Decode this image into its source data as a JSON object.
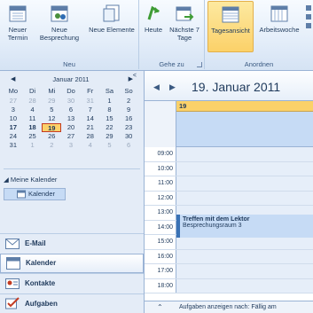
{
  "ribbon": {
    "groups": [
      {
        "label": "Neu",
        "buttons": [
          {
            "label": "Neuer Termin"
          },
          {
            "label": "Neue Besprechung"
          },
          {
            "label": "Neue Elemente"
          }
        ]
      },
      {
        "label": "Gehe zu",
        "buttons": [
          {
            "label": "Heute"
          },
          {
            "label": "Nächste 7 Tage"
          }
        ]
      },
      {
        "label": "Anordnen",
        "buttons": [
          {
            "label": "Tagesansicht"
          },
          {
            "label": "Arbeitswoche"
          }
        ]
      }
    ]
  },
  "mini_calendar": {
    "month": "Januar 2011",
    "weekdays": [
      "Mo",
      "Di",
      "Mi",
      "Do",
      "Fr",
      "Sa",
      "So"
    ],
    "weeks": [
      [
        "27",
        "28",
        "29",
        "30",
        "31",
        "1",
        "2"
      ],
      [
        "3",
        "4",
        "5",
        "6",
        "7",
        "8",
        "9"
      ],
      [
        "10",
        "11",
        "12",
        "13",
        "14",
        "15",
        "16"
      ],
      [
        "17",
        "18",
        "19",
        "20",
        "21",
        "22",
        "23"
      ],
      [
        "24",
        "25",
        "26",
        "27",
        "28",
        "29",
        "30"
      ],
      [
        "31",
        "1",
        "2",
        "3",
        "4",
        "5",
        "6"
      ]
    ],
    "selected_day": "19"
  },
  "calendars": {
    "group": "Meine Kalender",
    "items": [
      "Kalender"
    ]
  },
  "nav_buttons": [
    "E-Mail",
    "Kalender",
    "Kontakte",
    "Aufgaben"
  ],
  "day_view": {
    "date_title": "19. Januar 2011",
    "column_header": "19",
    "hours": [
      "09:00",
      "10:00",
      "11:00",
      "12:00",
      "13:00",
      "14:00",
      "15:00",
      "16:00",
      "17:00",
      "18:00"
    ],
    "appointment": {
      "title": "Treffen mit dem Lektor",
      "location": "Besprechungsraum 3"
    },
    "tasks_label": "Aufgaben anzeigen nach: Fällig am"
  },
  "colors": {
    "accent": "#fbd169",
    "appointment": "#c6dbf5",
    "nav_bg": "#e4ecf7"
  }
}
